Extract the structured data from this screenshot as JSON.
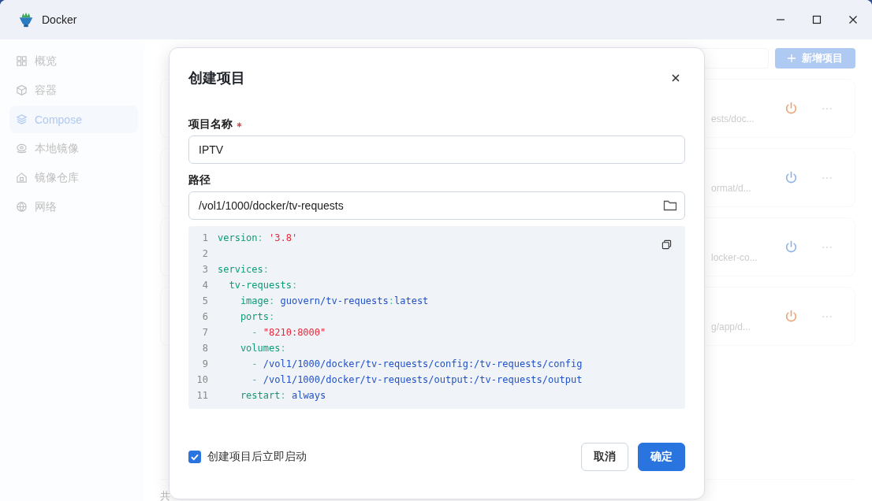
{
  "window": {
    "title": "Docker"
  },
  "sidebar": {
    "items": [
      {
        "label": "概览",
        "selected": false
      },
      {
        "label": "容器",
        "selected": false
      },
      {
        "label": "Compose",
        "selected": true
      },
      {
        "label": "本地镜像",
        "selected": false
      },
      {
        "label": "镜像仓库",
        "selected": false
      },
      {
        "label": "网络",
        "selected": false
      }
    ]
  },
  "main": {
    "add_button": "新增项目",
    "projects": [
      {
        "path": "ests/doc...",
        "color": "#f0a070"
      },
      {
        "path": "ormat/d...",
        "color": "#8aaee8"
      },
      {
        "path": "locker-co...",
        "color": "#8aaee8"
      },
      {
        "path": "g/app/d...",
        "color": "#f0a070"
      }
    ],
    "footer": "共"
  },
  "dialog": {
    "title": "创建项目",
    "fields": [
      {
        "label": "项目名称",
        "required": true,
        "value": "IPTV",
        "kind": "text"
      },
      {
        "label": "路径",
        "required": false,
        "value": "/vol1/1000/docker/tv-requests",
        "kind": "folder"
      }
    ],
    "code": [
      {
        "number": "1",
        "tokens": [
          {
            "kind": "key",
            "text": "version"
          },
          {
            "kind": "punct",
            "text": ": "
          },
          {
            "kind": "string",
            "text": "'3.8'"
          }
        ]
      },
      {
        "number": "2"
      },
      {
        "number": "3",
        "tokens": [
          {
            "kind": "key",
            "text": "services"
          },
          {
            "kind": "punct",
            "text": ":"
          }
        ]
      },
      {
        "number": "4",
        "tokens": [
          {
            "kind": "key",
            "text": "  tv-requests"
          },
          {
            "kind": "punct",
            "text": ":"
          }
        ]
      },
      {
        "number": "5",
        "tokens": [
          {
            "kind": "key",
            "text": "    image"
          },
          {
            "kind": "punct",
            "text": ": "
          },
          {
            "kind": "value",
            "text": "guovern/tv-requests"
          },
          {
            "kind": "punct",
            "text": ":"
          },
          {
            "kind": "value",
            "text": "latest"
          }
        ]
      },
      {
        "number": "6",
        "tokens": [
          {
            "kind": "key",
            "text": "    ports"
          },
          {
            "kind": "punct",
            "text": ":"
          }
        ]
      },
      {
        "number": "7",
        "tokens": [
          {
            "kind": "dash",
            "text": "      - "
          },
          {
            "kind": "string",
            "text": "\"8210:8000\""
          }
        ]
      },
      {
        "number": "8",
        "tokens": [
          {
            "kind": "key",
            "text": "    volumes"
          },
          {
            "kind": "punct",
            "text": ":"
          }
        ]
      },
      {
        "number": "9",
        "tokens": [
          {
            "kind": "dash",
            "text": "      - "
          },
          {
            "kind": "value",
            "text": "/vol1/1000/docker/tv-requests/config:/tv-requests/config"
          }
        ]
      },
      {
        "number": "10",
        "tokens": [
          {
            "kind": "dash",
            "text": "      - "
          },
          {
            "kind": "value",
            "text": "/vol1/1000/docker/tv-requests/output:/tv-requests/output"
          }
        ]
      },
      {
        "number": "11",
        "tokens": [
          {
            "kind": "key",
            "text": "    restart"
          },
          {
            "kind": "punct",
            "text": ": "
          },
          {
            "kind": "value",
            "text": "always"
          }
        ]
      }
    ],
    "start_after_create": {
      "label": "创建项目后立即启动",
      "checked": true
    },
    "buttons": [
      {
        "label": "取消",
        "kind": "secondary"
      },
      {
        "label": "确定",
        "kind": "primary"
      }
    ]
  }
}
